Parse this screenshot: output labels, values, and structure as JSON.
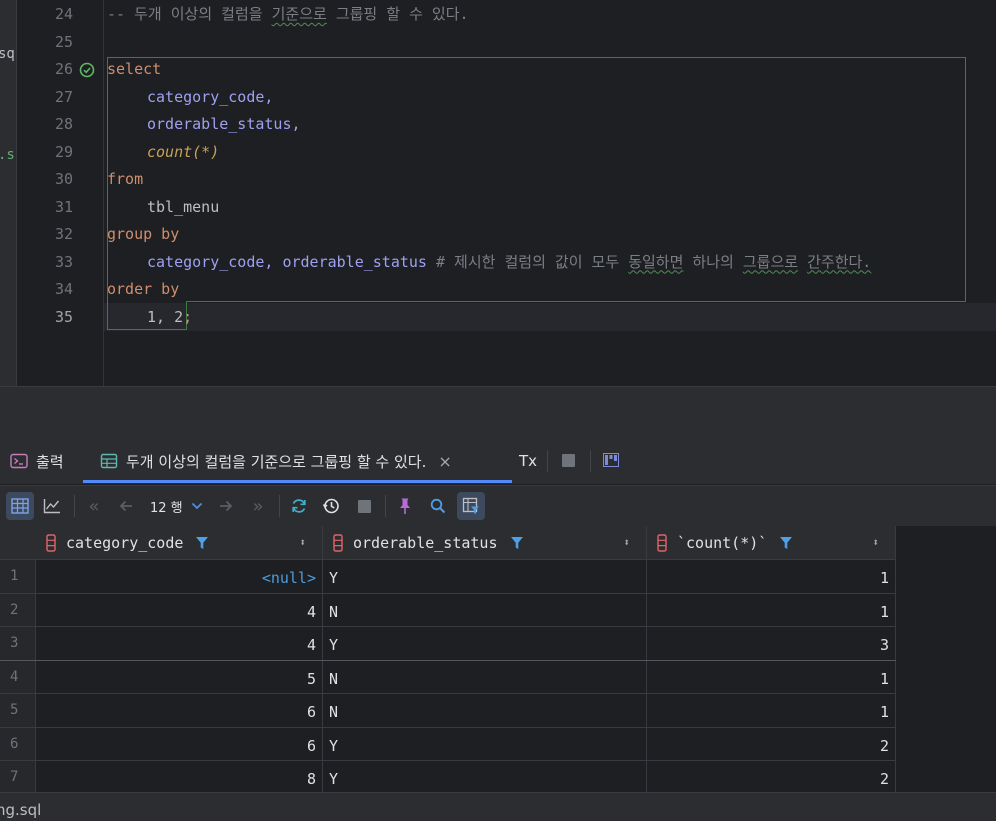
{
  "left_strip": {
    "frag_top": "sql",
    "frag_mid": ".sc"
  },
  "editor": {
    "line_numbers": [
      "24",
      "25",
      "26",
      "27",
      "28",
      "29",
      "30",
      "31",
      "32",
      "33",
      "34",
      "35"
    ],
    "line24_comment": "-- 두개 이상의 컬럼을 기준으로 그룹핑 할 수 있다.",
    "kw_select": "select",
    "col_category_code": "category_code,",
    "col_orderable_status": "orderable_status,",
    "fn_count": "count(*)",
    "kw_from": "from",
    "table_name": "tbl_menu",
    "kw_group_by": "group by",
    "group_cols_a": "category_code,",
    "group_cols_b": "orderable_status",
    "line33_comment": "# 제시한 컬럼의 값이 모두 동일하면 하나의 그룹으로 간주한다.",
    "kw_order_by": "order by",
    "order_cols": "1, 2",
    "semicolon": ";"
  },
  "tabs": {
    "output_label": "출력",
    "result_label": "두개 이상의 컬럼을 기준으로 그룹핑 할 수 있다.",
    "close_glyph": "×",
    "tx_label": "Tx"
  },
  "toolbar": {
    "page_size": "12 행",
    "icons": [
      "table-view-icon",
      "chart-view-icon",
      "first-page-icon",
      "prev-page-icon",
      "next-page-icon",
      "last-page-icon",
      "refresh-icon",
      "history-icon",
      "stop-icon",
      "pin-icon",
      "search-icon",
      "filter-icon"
    ]
  },
  "grid": {
    "columns": [
      "category_code",
      "orderable_status",
      "`count(*)`"
    ],
    "rows": [
      {
        "n": "1",
        "category_code": "<null>",
        "orderable_status": "Y",
        "count": "1"
      },
      {
        "n": "2",
        "category_code": "4",
        "orderable_status": "N",
        "count": "1"
      },
      {
        "n": "3",
        "category_code": "4",
        "orderable_status": "Y",
        "count": "3"
      },
      {
        "n": "4",
        "category_code": "5",
        "orderable_status": "N",
        "count": "1"
      },
      {
        "n": "5",
        "category_code": "6",
        "orderable_status": "N",
        "count": "1"
      },
      {
        "n": "6",
        "category_code": "6",
        "orderable_status": "Y",
        "count": "2"
      },
      {
        "n": "7",
        "category_code": "8",
        "orderable_status": "Y",
        "count": "2"
      }
    ]
  },
  "bottom": {
    "file_fragment": "ng.sql"
  },
  "colors": {
    "accent": "#548af7",
    "keyword": "#cf8e6d",
    "column": "#c77dbb",
    "function": "#c8a056",
    "null": "#4c9ddc",
    "statement_border": "#3e7a47"
  }
}
